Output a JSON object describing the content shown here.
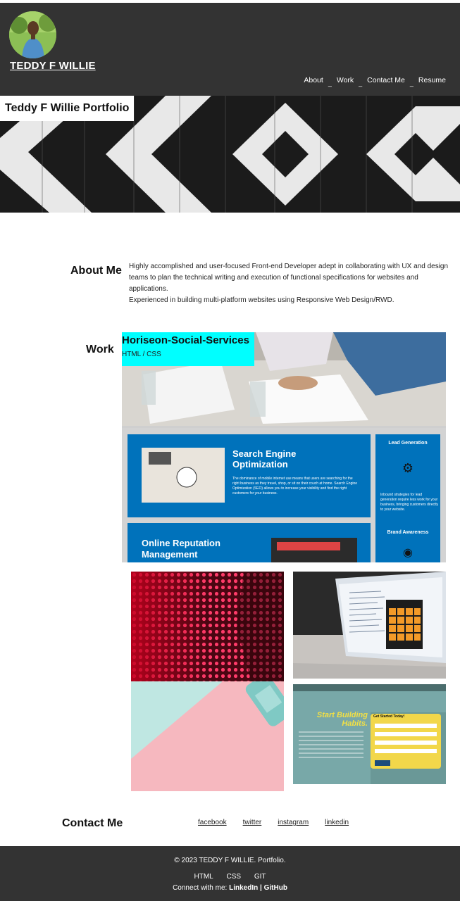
{
  "header": {
    "brand": "TEDDY F WILLIE",
    "nav": [
      {
        "label": "About"
      },
      {
        "label": "Work"
      },
      {
        "label": "Contact Me"
      },
      {
        "label": "Resume"
      }
    ],
    "separator": "_"
  },
  "hero": {
    "title": "Teddy F Willie Portfolio"
  },
  "about": {
    "heading": "About Me",
    "paragraph1": "Highly accomplished and user-focused Front-end Developer adept in collaborating with UX and design teams to plan the technical writing and execution of functional specifications for websites and applications.",
    "paragraph2": "Experienced in building multi-platform websites using Responsive Web Design/RWD."
  },
  "work": {
    "heading": "Work",
    "feature": {
      "title": "Horiseon-Social-Services",
      "subtitle": "HTML / CSS",
      "screenshot": {
        "seo_title": "Search Engine Optimization",
        "seo_body": "The dominance of mobile internet use means that users are searching for the right business as they travel, shop, or sit on their couch at home. Search Engine Optimization (SEO) allows you to increase your visibility and find the right customers for your business.",
        "lead_title": "Lead Generation",
        "lead_body": "Inbound strategies for lead generation require less work for your business, bringing customers directly to your website.",
        "brand_title": "Brand Awareness",
        "rep_title": "Online Reputation Management"
      }
    },
    "tiles": [
      {
        "name": "red-led-wall"
      },
      {
        "name": "laptop-code"
      },
      {
        "name": "pink-mint-desk"
      },
      {
        "name": "habit-app",
        "headline": "Start Building Habits.",
        "card_title": "Get Started Today!"
      }
    ]
  },
  "contact": {
    "heading": "Contact Me",
    "links": [
      "facebook",
      "twitter",
      "instagram",
      "linkedin"
    ]
  },
  "footer": {
    "copyright": "© 2023 TEDDY F WILLIE. Portfolio.",
    "links": [
      "HTML",
      "CSS",
      "GIT"
    ],
    "connect_prefix": "Connect with me:",
    "connect_linkedin": "LinkedIn",
    "connect_divider": "|",
    "connect_github": "GitHub"
  },
  "colors": {
    "header_bg": "#333333",
    "work_label_bg": "#00ffff",
    "horiseon_blue": "#0072bb"
  }
}
